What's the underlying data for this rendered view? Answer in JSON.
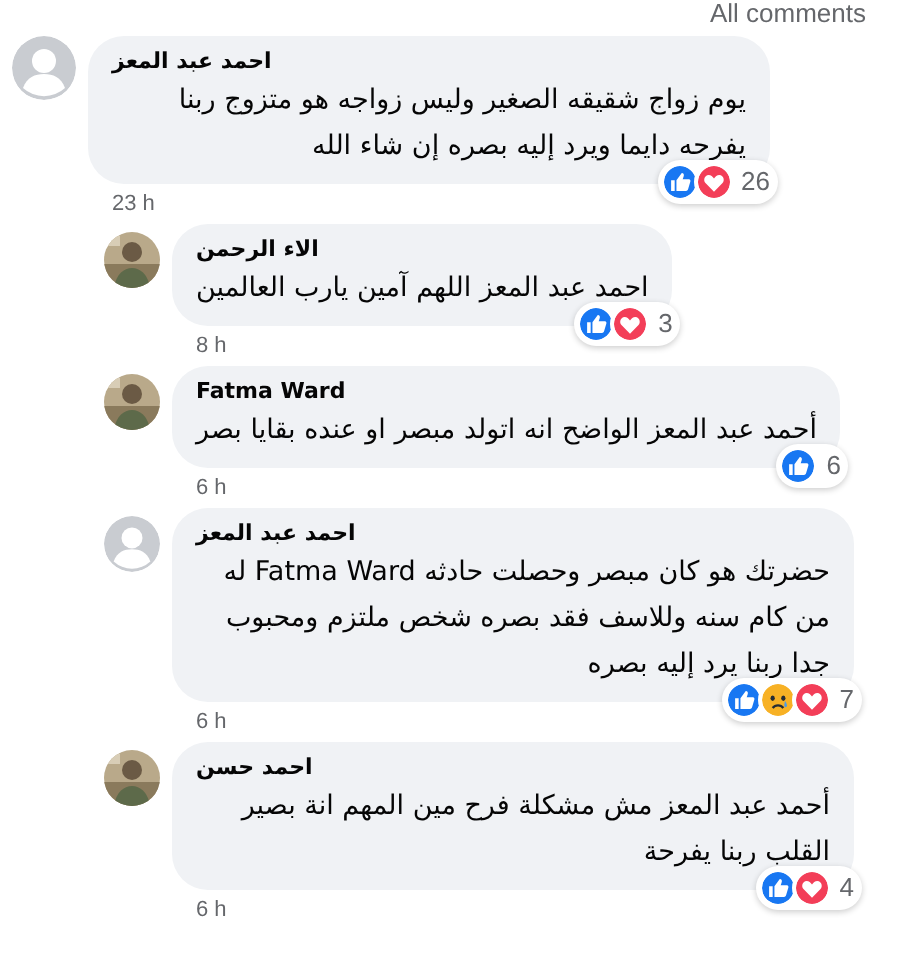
{
  "header": {
    "link": "All comments"
  },
  "comments": [
    {
      "author": "احمد عبد المعز",
      "kind": "silhouette",
      "text": "يوم زواج شقيقه الصغير وليس زواجه هو متزوج ربنا يفرحه دايما ويرد إليه بصره إن شاء الله",
      "time": "23 h",
      "reactions": [
        {
          "kind": "like"
        },
        {
          "kind": "love"
        }
      ],
      "count": "26",
      "children": [
        {
          "author": "الاء الرحمن",
          "kind": "picture",
          "text": "احمد عبد المعز اللهم آمين يارب العالمين",
          "time": "8 h",
          "reactions": [
            {
              "kind": "like"
            },
            {
              "kind": "love"
            }
          ],
          "count": "3"
        },
        {
          "author": "Fatma Ward",
          "kind": "picture",
          "text": "أحمد عبد المعز الواضح انه اتولد مبصر او عنده بقايا بصر",
          "time": "6 h",
          "reactions": [
            {
              "kind": "like"
            }
          ],
          "count": "6"
        },
        {
          "author": "احمد عبد المعز",
          "kind": "silhouette",
          "text": "حضرتك هو كان مبصر وحصلت حادثه Fatma Ward له من كام سنه وللاسف فقد بصره شخص ملتزم ومحبوب جدا ربنا يرد إليه بصره",
          "time": "6 h",
          "reactions": [
            {
              "kind": "like"
            },
            {
              "kind": "sad"
            },
            {
              "kind": "love"
            }
          ],
          "count": "7"
        },
        {
          "author": "احمد حسن",
          "kind": "picture",
          "text": "أحمد عبد المعز مش مشكلة فرح مين المهم انة بصير القلب ربنا يفرحة",
          "time": "6 h",
          "reactions": [
            {
              "kind": "like"
            },
            {
              "kind": "love"
            }
          ],
          "count": "4"
        }
      ]
    }
  ]
}
